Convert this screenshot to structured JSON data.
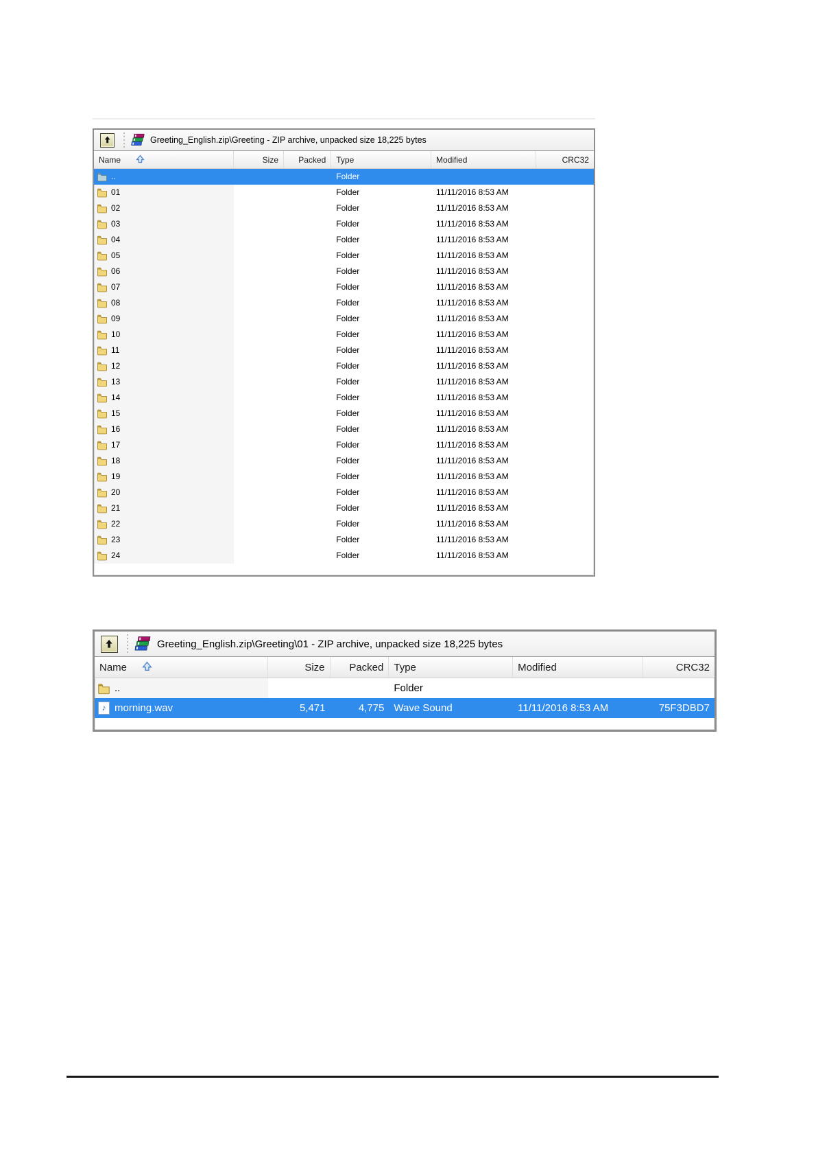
{
  "page": {
    "background": "#ffffff"
  },
  "colors": {
    "selection_blue": "#2f8bec",
    "folder_yellow": "#f2d67c",
    "window_border_gray": "#8d8d8d",
    "rule_black": "#161616"
  },
  "archive_window_top": {
    "toolbar": {
      "up_button": "up-one-level",
      "archive_icon": "winrar-archive",
      "title": "Greeting_English.zip\\Greeting - ZIP archive, unpacked size 18,225 bytes"
    },
    "columns": {
      "name": "Name",
      "size": "Size",
      "packed": "Packed",
      "type": "Type",
      "modified": "Modified",
      "crc": "CRC32"
    },
    "sort": {
      "column": "name",
      "direction": "ascending"
    },
    "rows": [
      {
        "name": "..",
        "icon": "folder-up",
        "size": "",
        "packed": "",
        "type": "Folder",
        "modified": "",
        "crc": "",
        "selected": true
      },
      {
        "name": "01",
        "icon": "folder",
        "size": "",
        "packed": "",
        "type": "Folder",
        "modified": "11/11/2016 8:53 AM",
        "crc": "",
        "selected": false
      },
      {
        "name": "02",
        "icon": "folder",
        "size": "",
        "packed": "",
        "type": "Folder",
        "modified": "11/11/2016 8:53 AM",
        "crc": "",
        "selected": false
      },
      {
        "name": "03",
        "icon": "folder",
        "size": "",
        "packed": "",
        "type": "Folder",
        "modified": "11/11/2016 8:53 AM",
        "crc": "",
        "selected": false
      },
      {
        "name": "04",
        "icon": "folder",
        "size": "",
        "packed": "",
        "type": "Folder",
        "modified": "11/11/2016 8:53 AM",
        "crc": "",
        "selected": false
      },
      {
        "name": "05",
        "icon": "folder",
        "size": "",
        "packed": "",
        "type": "Folder",
        "modified": "11/11/2016 8:53 AM",
        "crc": "",
        "selected": false
      },
      {
        "name": "06",
        "icon": "folder",
        "size": "",
        "packed": "",
        "type": "Folder",
        "modified": "11/11/2016 8:53 AM",
        "crc": "",
        "selected": false
      },
      {
        "name": "07",
        "icon": "folder",
        "size": "",
        "packed": "",
        "type": "Folder",
        "modified": "11/11/2016 8:53 AM",
        "crc": "",
        "selected": false
      },
      {
        "name": "08",
        "icon": "folder",
        "size": "",
        "packed": "",
        "type": "Folder",
        "modified": "11/11/2016 8:53 AM",
        "crc": "",
        "selected": false
      },
      {
        "name": "09",
        "icon": "folder",
        "size": "",
        "packed": "",
        "type": "Folder",
        "modified": "11/11/2016 8:53 AM",
        "crc": "",
        "selected": false
      },
      {
        "name": "10",
        "icon": "folder",
        "size": "",
        "packed": "",
        "type": "Folder",
        "modified": "11/11/2016 8:53 AM",
        "crc": "",
        "selected": false
      },
      {
        "name": "11",
        "icon": "folder",
        "size": "",
        "packed": "",
        "type": "Folder",
        "modified": "11/11/2016 8:53 AM",
        "crc": "",
        "selected": false
      },
      {
        "name": "12",
        "icon": "folder",
        "size": "",
        "packed": "",
        "type": "Folder",
        "modified": "11/11/2016 8:53 AM",
        "crc": "",
        "selected": false
      },
      {
        "name": "13",
        "icon": "folder",
        "size": "",
        "packed": "",
        "type": "Folder",
        "modified": "11/11/2016 8:53 AM",
        "crc": "",
        "selected": false
      },
      {
        "name": "14",
        "icon": "folder",
        "size": "",
        "packed": "",
        "type": "Folder",
        "modified": "11/11/2016 8:53 AM",
        "crc": "",
        "selected": false
      },
      {
        "name": "15",
        "icon": "folder",
        "size": "",
        "packed": "",
        "type": "Folder",
        "modified": "11/11/2016 8:53 AM",
        "crc": "",
        "selected": false
      },
      {
        "name": "16",
        "icon": "folder",
        "size": "",
        "packed": "",
        "type": "Folder",
        "modified": "11/11/2016 8:53 AM",
        "crc": "",
        "selected": false
      },
      {
        "name": "17",
        "icon": "folder",
        "size": "",
        "packed": "",
        "type": "Folder",
        "modified": "11/11/2016 8:53 AM",
        "crc": "",
        "selected": false
      },
      {
        "name": "18",
        "icon": "folder",
        "size": "",
        "packed": "",
        "type": "Folder",
        "modified": "11/11/2016 8:53 AM",
        "crc": "",
        "selected": false
      },
      {
        "name": "19",
        "icon": "folder",
        "size": "",
        "packed": "",
        "type": "Folder",
        "modified": "11/11/2016 8:53 AM",
        "crc": "",
        "selected": false
      },
      {
        "name": "20",
        "icon": "folder",
        "size": "",
        "packed": "",
        "type": "Folder",
        "modified": "11/11/2016 8:53 AM",
        "crc": "",
        "selected": false
      },
      {
        "name": "21",
        "icon": "folder",
        "size": "",
        "packed": "",
        "type": "Folder",
        "modified": "11/11/2016 8:53 AM",
        "crc": "",
        "selected": false
      },
      {
        "name": "22",
        "icon": "folder",
        "size": "",
        "packed": "",
        "type": "Folder",
        "modified": "11/11/2016 8:53 AM",
        "crc": "",
        "selected": false
      },
      {
        "name": "23",
        "icon": "folder",
        "size": "",
        "packed": "",
        "type": "Folder",
        "modified": "11/11/2016 8:53 AM",
        "crc": "",
        "selected": false
      },
      {
        "name": "24",
        "icon": "folder",
        "size": "",
        "packed": "",
        "type": "Folder",
        "modified": "11/11/2016 8:53 AM",
        "crc": "",
        "selected": false
      }
    ]
  },
  "archive_window_bottom": {
    "toolbar": {
      "up_button": "up-one-level",
      "archive_icon": "winrar-archive",
      "title": "Greeting_English.zip\\Greeting\\01 - ZIP archive, unpacked size 18,225 bytes"
    },
    "columns": {
      "name": "Name",
      "size": "Size",
      "packed": "Packed",
      "type": "Type",
      "modified": "Modified",
      "crc": "CRC32"
    },
    "sort": {
      "column": "name",
      "direction": "ascending"
    },
    "rows": [
      {
        "name": "..",
        "icon": "folder",
        "size": "",
        "packed": "",
        "type": "Folder",
        "modified": "",
        "crc": "",
        "selected": false
      },
      {
        "name": "morning.wav",
        "icon": "wav-file",
        "size": "5,471",
        "packed": "4,775",
        "type": "Wave Sound",
        "modified": "11/11/2016 8:53 AM",
        "crc": "75F3DBD7",
        "selected": true
      }
    ]
  }
}
